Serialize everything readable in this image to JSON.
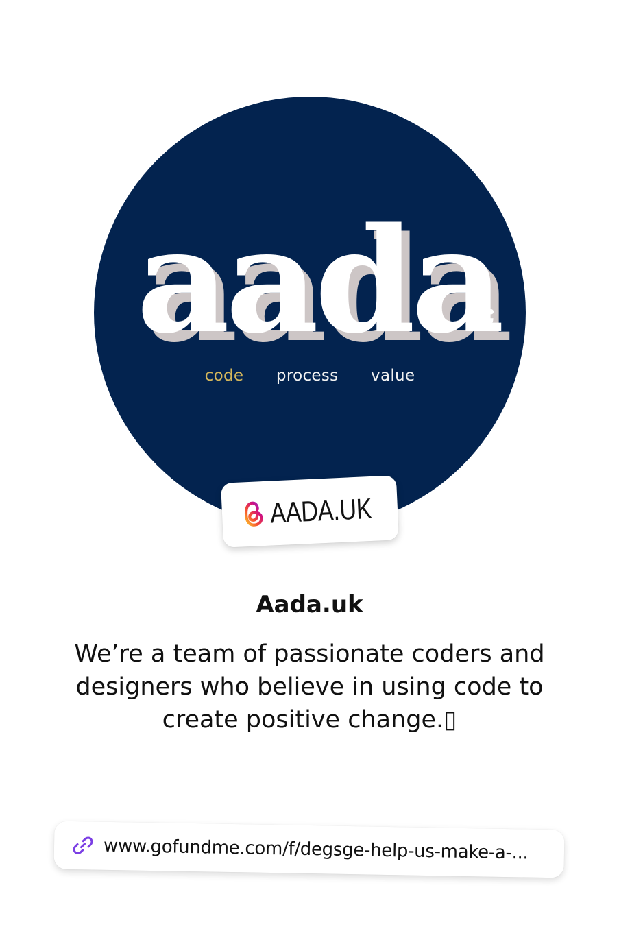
{
  "avatar": {
    "logo_text": "aada",
    "logo_punct": ";",
    "tagline": {
      "code": "code",
      "process": "process",
      "value": "value"
    }
  },
  "handle_badge": {
    "icon": "threads-icon",
    "text": "AADA.UK"
  },
  "profile": {
    "name": "Aada.uk",
    "bio_line1": "We’re a team of passionate coders and",
    "bio_line2": "designers who believe in using code to",
    "bio_line3": "create positive change.▯"
  },
  "link": {
    "icon": "link-icon",
    "text": "www.gofundme.com/f/degsge-help-us-make-a-..."
  },
  "colors": {
    "avatar_bg": "#03234f",
    "tagline_accent": "#d4b65b",
    "link_icon": "#7b3fe4"
  }
}
